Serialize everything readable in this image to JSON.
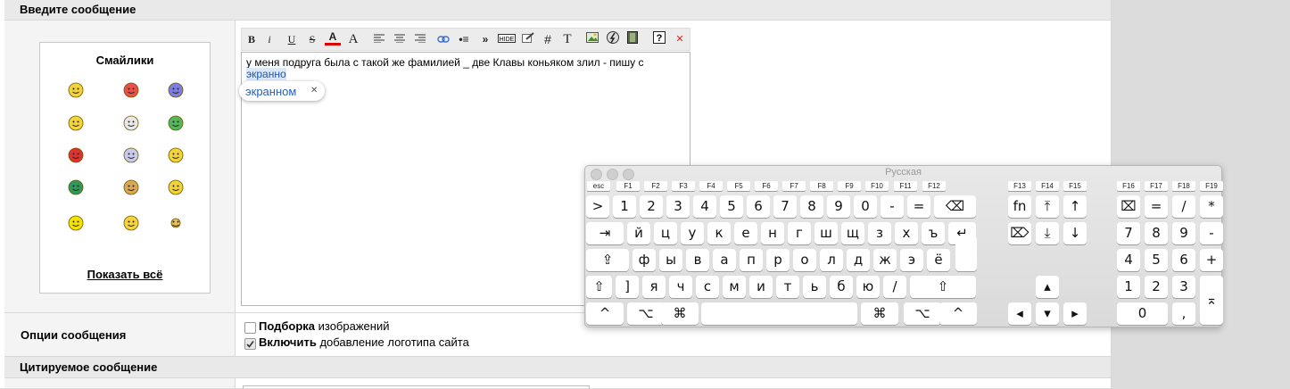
{
  "sections": {
    "message_header": "Введите сообщение",
    "options_label": "Опции сообщения",
    "quoted_header": "Цитируемое сообщение"
  },
  "smilies": {
    "title": "Смайлики",
    "show_all": "Показать всё",
    "items": [
      "cool-smiley-icon",
      "love-smiley-icon",
      "blue-smiley-icon",
      "thinking-smiley-icon",
      "kiss-smiley-icon",
      "green-smiley-icon",
      "shooting-smiley-icon",
      "waving-smiley-icon",
      "crazy-smiley-icon",
      "pacman-smiley-icon",
      "clapping-smiley-icon",
      "cheerleader-smiley-icon",
      "dancing-smiley-icon",
      "laughing-smiley-icon",
      "star-smiley-icon"
    ]
  },
  "toolbar": {
    "bold": "B",
    "italic": "i",
    "underline": "U",
    "strike": "S",
    "color": "A",
    "size": "A",
    "list": "•≡",
    "more": "»",
    "hash": "#",
    "typeface": "T",
    "close": "✕"
  },
  "editor": {
    "text_line1": "у меня подруга была с такой же фамилией _ две Клавы коньяком злил - пишу с",
    "text_line2": "экранно",
    "suggestion": "экранном",
    "suggestion_close": "✕"
  },
  "options": {
    "opt1_bold": "Подборка",
    "opt1_rest": " изображений",
    "opt1_checked": false,
    "opt2_bold": "Включить",
    "opt2_rest": " добавление логотипа сайта",
    "opt2_checked": true
  },
  "keyboard": {
    "title": "Русская",
    "f_keys": [
      "esc",
      "F1",
      "F2",
      "F3",
      "F4",
      "F5",
      "F6",
      "F7",
      "F8",
      "F9",
      "F10",
      "F11",
      "F12"
    ],
    "f_keys_mid": [
      "F13",
      "F14",
      "F15"
    ],
    "f_keys_right": [
      "F16",
      "F17",
      "F18",
      "F19"
    ],
    "row1": [
      ">",
      "1",
      "2",
      "3",
      "4",
      "5",
      "6",
      "7",
      "8",
      "9",
      "0",
      "-",
      "=",
      "⌫"
    ],
    "row2": [
      "⇥",
      "й",
      "ц",
      "у",
      "к",
      "е",
      "н",
      "г",
      "ш",
      "щ",
      "з",
      "х",
      "ъ",
      "↵"
    ],
    "row3": [
      "⇪",
      "ф",
      "ы",
      "в",
      "а",
      "п",
      "р",
      "о",
      "л",
      "д",
      "ж",
      "э",
      "ё"
    ],
    "row4": [
      "⇧",
      "]",
      "я",
      "ч",
      "с",
      "м",
      "и",
      "т",
      "ь",
      "б",
      "ю",
      "/",
      "⇧"
    ],
    "row5": [
      "^",
      "⌥",
      "⌘",
      "",
      "⌘",
      "⌥",
      "^"
    ],
    "nav": [
      "fn",
      "⤒",
      "↑",
      "⌦",
      "⤓",
      "↓",
      "▴",
      "◂",
      "▾",
      "▸"
    ],
    "numpad": [
      "⌧",
      "=",
      "/",
      "*",
      "7",
      "8",
      "9",
      "-",
      "4",
      "5",
      "6",
      "+",
      "1",
      "2",
      "3",
      "⌅",
      "0",
      ","
    ]
  }
}
